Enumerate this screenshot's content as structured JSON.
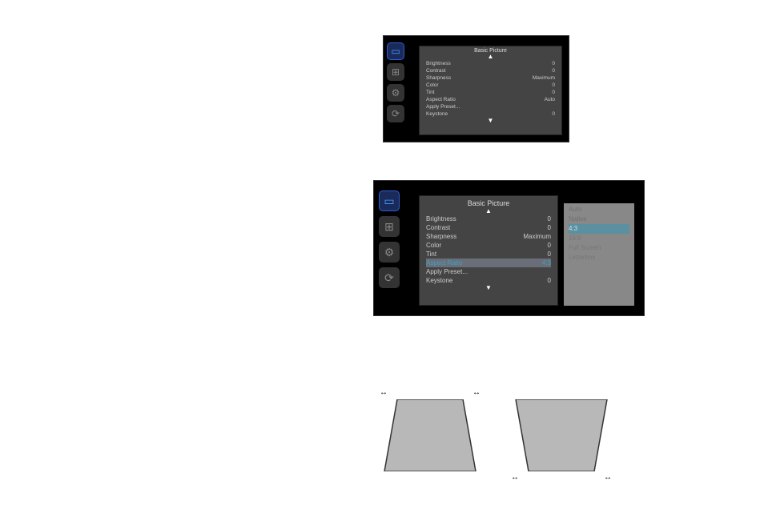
{
  "sidebar": {
    "icons": [
      "picture-icon",
      "advanced-icon",
      "settings-icon",
      "source-icon"
    ]
  },
  "menu1": {
    "title": "Basic Picture",
    "items": [
      {
        "label": "Brightness",
        "value": "0"
      },
      {
        "label": "Contrast",
        "value": "0"
      },
      {
        "label": "Sharpness",
        "value": "Maximum"
      },
      {
        "label": "Color",
        "value": "0"
      },
      {
        "label": "Tint",
        "value": "0"
      },
      {
        "label": "Aspect Ratio",
        "value": "Auto"
      },
      {
        "label": "Apply Preset...",
        "value": ""
      },
      {
        "label": "Keystone",
        "value": "0"
      }
    ]
  },
  "menu2": {
    "title": "Basic Picture",
    "items": [
      {
        "label": "Brightness",
        "value": "0"
      },
      {
        "label": "Contrast",
        "value": "0"
      },
      {
        "label": "Sharpness",
        "value": "Maximum"
      },
      {
        "label": "Color",
        "value": "0"
      },
      {
        "label": "Tint",
        "value": "0"
      },
      {
        "label": "Aspect Ratio",
        "value": "4:3",
        "hl": true
      },
      {
        "label": "Apply Preset...",
        "value": ""
      },
      {
        "label": "Keystone",
        "value": "0"
      }
    ],
    "submenu": [
      {
        "label": "Auto"
      },
      {
        "label": "Native"
      },
      {
        "label": "4:3",
        "sel": true
      },
      {
        "label": "16:9"
      },
      {
        "label": "Full Screen"
      },
      {
        "label": "Letterbox"
      }
    ]
  }
}
